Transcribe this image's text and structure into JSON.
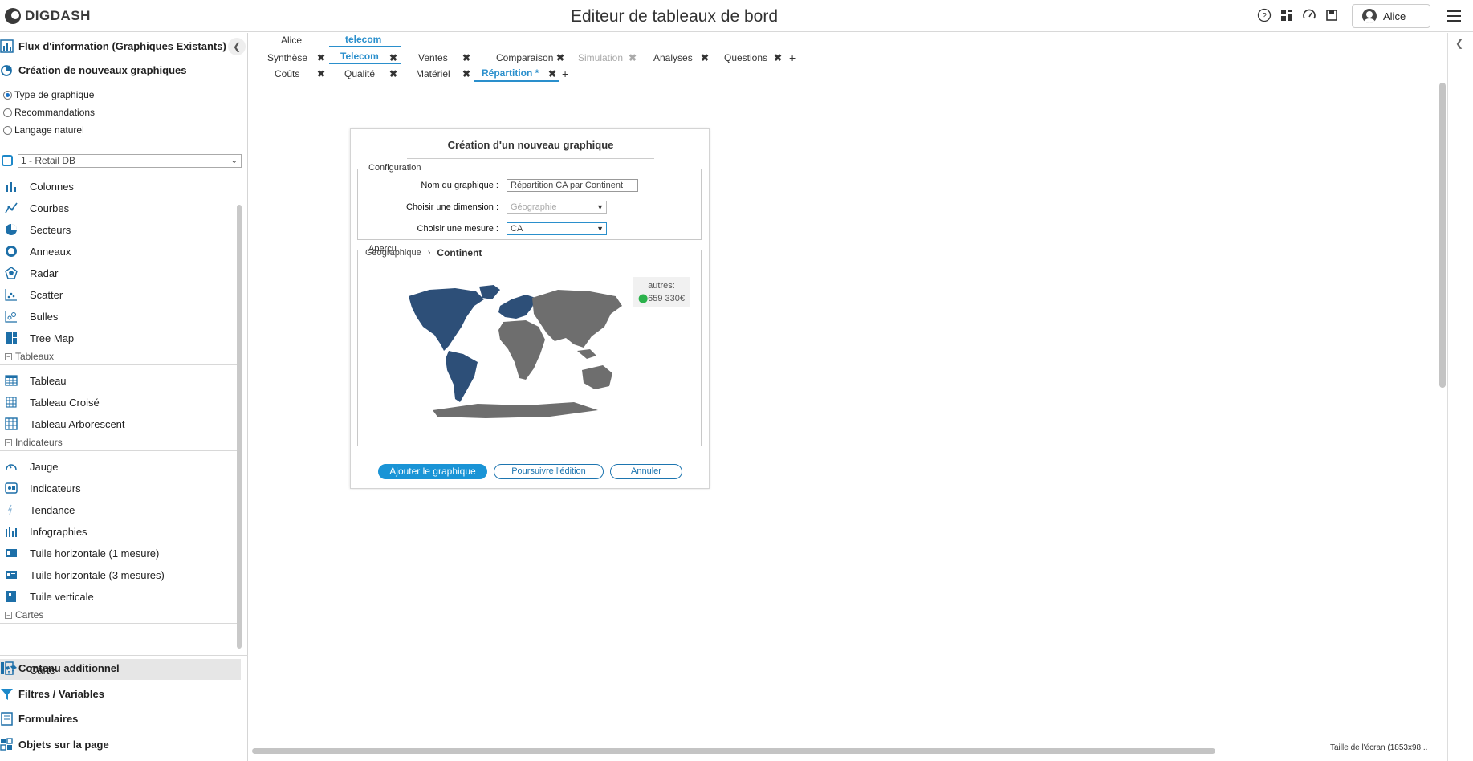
{
  "app": {
    "brand": "DIGDASH",
    "title": "Editeur de tableaux de bord",
    "user": "Alice",
    "top_icons": [
      "help-icon",
      "dashboard-icon",
      "gauge-icon",
      "save-icon"
    ]
  },
  "sidebar": {
    "flux_label": "Flux d'information (Graphiques Existants)",
    "create_label": "Création de nouveaux graphiques",
    "modes": [
      {
        "label": "Type de graphique",
        "checked": true
      },
      {
        "label": "Recommandations",
        "checked": false
      },
      {
        "label": "Langage naturel",
        "checked": false
      }
    ],
    "datasource": "1 - Retail DB",
    "charts": [
      "Colonnes",
      "Courbes",
      "Secteurs",
      "Anneaux",
      "Radar",
      "Scatter",
      "Bulles",
      "Tree Map"
    ],
    "group_tableaux": "Tableaux",
    "tableaux": [
      "Tableau",
      "Tableau Croisé",
      "Tableau Arborescent"
    ],
    "group_indicateurs": "Indicateurs",
    "indicateurs": [
      "Jauge",
      "Indicateurs",
      "Tendance",
      "Infographies",
      "Tuile horizontale (1 mesure)",
      "Tuile horizontale (3 mesures)",
      "Tuile verticale"
    ],
    "group_cartes": "Cartes",
    "cartes": [
      "Carte"
    ],
    "bottom": [
      "Contenu additionnel",
      "Filtres / Variables",
      "Formulaires",
      "Objets sur la page"
    ]
  },
  "tabs": {
    "level1": [
      "Alice",
      "telecom"
    ],
    "row1": [
      "Synthèse",
      "Telecom",
      "Ventes",
      "Comparaison",
      "Simulation",
      "Analyses",
      "Questions"
    ],
    "row2": [
      "Coûts",
      "Qualité",
      "Matériel",
      "Répartition *"
    ],
    "add": "+",
    "close": "✖"
  },
  "dialog": {
    "title": "Création d'un nouveau graphique",
    "config_legend": "Configuration",
    "name_label": "Nom du graphique :",
    "name_value": "Répartition CA par Continent",
    "dimension_label": "Choisir une dimension :",
    "dimension_value": "Géographie",
    "measure_label": "Choisir une mesure :",
    "measure_value": "CA",
    "preview_legend": "Aperçu",
    "crumb_root": "Géographique",
    "crumb_leaf": "Continent",
    "others_label": "autres:",
    "others_value": "659 330€",
    "btn_add": "Ajouter le graphique",
    "btn_continue": "Poursuivre l'édition",
    "btn_cancel": "Annuler"
  },
  "status": "Taille de l'écran (1853x98...",
  "colors": {
    "accent": "#2a8fcc",
    "map_highlight": "#2d4f78",
    "map_other": "#6e6e6e"
  }
}
